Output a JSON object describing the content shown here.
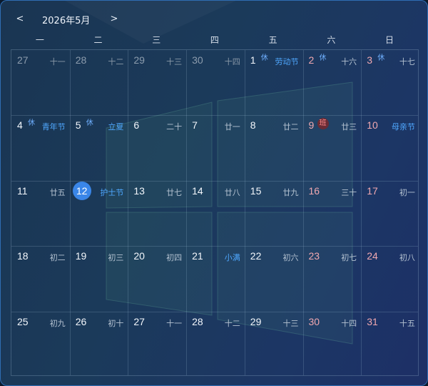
{
  "nav": {
    "prev_label": "<",
    "next_label": ">",
    "month_title": "2026年5月"
  },
  "weekdays": [
    "一",
    "二",
    "三",
    "四",
    "五",
    "六",
    "日"
  ],
  "days": [
    {
      "day": "27",
      "lunar": "十一",
      "dim": true
    },
    {
      "day": "28",
      "lunar": "十二",
      "dim": true
    },
    {
      "day": "29",
      "lunar": "十三",
      "dim": true
    },
    {
      "day": "30",
      "lunar": "十四",
      "dim": true
    },
    {
      "day": "1",
      "lunar": "劳动节",
      "fest": true,
      "badge": "休"
    },
    {
      "day": "2",
      "lunar": "十六",
      "weekend": true,
      "badge": "休"
    },
    {
      "day": "3",
      "lunar": "十七",
      "weekend": true,
      "badge": "休"
    },
    {
      "day": "4",
      "lunar": "青年节",
      "fest": true,
      "badge": "休"
    },
    {
      "day": "5",
      "lunar": "立夏",
      "fest": true,
      "badge": "休"
    },
    {
      "day": "6",
      "lunar": "二十"
    },
    {
      "day": "7",
      "lunar": "廿一"
    },
    {
      "day": "8",
      "lunar": "廿二"
    },
    {
      "day": "9",
      "lunar": "廿三",
      "weekend": true,
      "badge": "班",
      "work": true
    },
    {
      "day": "10",
      "lunar": "母亲节",
      "fest": true,
      "weekend": true
    },
    {
      "day": "11",
      "lunar": "廿五"
    },
    {
      "day": "12",
      "lunar": "护士节",
      "fest": true,
      "today": true
    },
    {
      "day": "13",
      "lunar": "廿七"
    },
    {
      "day": "14",
      "lunar": "廿八"
    },
    {
      "day": "15",
      "lunar": "廿九"
    },
    {
      "day": "16",
      "lunar": "三十",
      "weekend": true
    },
    {
      "day": "17",
      "lunar": "初一",
      "weekend": true
    },
    {
      "day": "18",
      "lunar": "初二"
    },
    {
      "day": "19",
      "lunar": "初三"
    },
    {
      "day": "20",
      "lunar": "初四"
    },
    {
      "day": "21",
      "lunar": "小满",
      "fest": true
    },
    {
      "day": "22",
      "lunar": "初六"
    },
    {
      "day": "23",
      "lunar": "初七",
      "weekend": true
    },
    {
      "day": "24",
      "lunar": "初八",
      "weekend": true
    },
    {
      "day": "25",
      "lunar": "初九"
    },
    {
      "day": "26",
      "lunar": "初十"
    },
    {
      "day": "27",
      "lunar": "十一"
    },
    {
      "day": "28",
      "lunar": "十二"
    },
    {
      "day": "29",
      "lunar": "十三"
    },
    {
      "day": "30",
      "lunar": "十四",
      "weekend": true
    },
    {
      "day": "31",
      "lunar": "十五",
      "weekend": true
    }
  ]
}
